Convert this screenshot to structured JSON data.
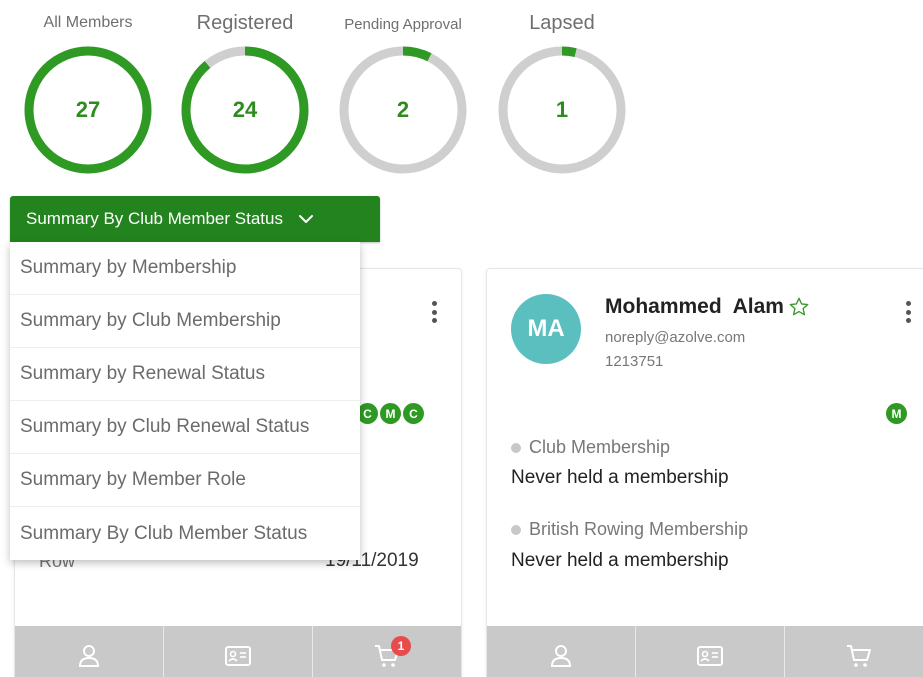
{
  "stats": [
    {
      "label": "All Members",
      "value": "27",
      "fraction": 1.0
    },
    {
      "label": "Registered",
      "value": "24",
      "fraction": 0.89
    },
    {
      "label": "Pending Approval",
      "value": "2",
      "fraction": 0.074
    },
    {
      "label": "Lapsed",
      "value": "1",
      "fraction": 0.037
    }
  ],
  "dropdown": {
    "selected": "Summary By Club Member Status",
    "options": [
      "Summary by Membership",
      "Summary by Club Membership",
      "Summary by Renewal Status",
      "Summary by Club Renewal Status",
      "Summary by Member Role",
      "Summary By Club Member Status"
    ]
  },
  "left_card": {
    "badges": [
      "C",
      "M",
      "C"
    ],
    "row_label": "Row",
    "date": "19/11/2019",
    "cart_count": "1"
  },
  "right_card": {
    "initials": "MA",
    "name": "Mohammed  Alam",
    "email": "noreply@azolve.com",
    "member_number": "1213751",
    "badge": "M",
    "club_membership_title": "Club Membership",
    "club_membership_value": "Never held a membership",
    "br_membership_title": "British Rowing Membership",
    "br_membership_value": "Never held a membership"
  },
  "colors": {
    "accent_green": "#23831e",
    "ring_green": "#2e9a23",
    "ring_grey": "#cfcfcf",
    "avatar_teal": "#5bbfc0",
    "notification_red": "#e84b4b"
  }
}
